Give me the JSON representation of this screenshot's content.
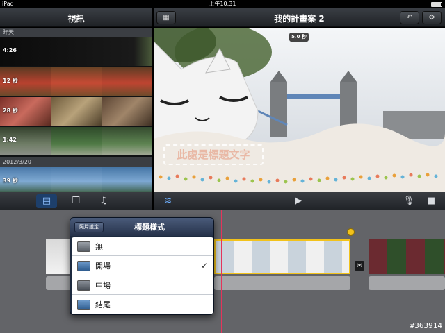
{
  "status_bar": {
    "carrier": "iPad",
    "time": "上午10:31"
  },
  "media_browser": {
    "title": "視訊",
    "sections": [
      {
        "label": "昨天",
        "clips": [
          {
            "duration": "4:26"
          },
          {
            "duration": "12 秒"
          },
          {
            "duration": "28 秒"
          },
          {
            "duration": "1:42"
          }
        ]
      },
      {
        "label": "2012/3/20",
        "clips": [
          {
            "duration": "39 秒"
          }
        ]
      }
    ]
  },
  "project": {
    "title": "我的計畫案 2",
    "clip_duration_badge": "5.0 秒",
    "title_placeholder": "此處是標題文字"
  },
  "title_style_popover": {
    "back_label": "照片設定",
    "title": "標題樣式",
    "options": [
      {
        "label": "無",
        "selected": false,
        "icon": "none-style-icon"
      },
      {
        "label": "開場",
        "selected": true,
        "icon": "opening-style-icon"
      },
      {
        "label": "中場",
        "selected": false,
        "icon": "middle-style-icon"
      },
      {
        "label": "結尾",
        "selected": false,
        "icon": "ending-style-icon"
      }
    ],
    "check_mark": "✓"
  },
  "watermark": "#363914",
  "colors": {
    "accent_blue": "#1d3f6b",
    "playhead": "#e5355c",
    "selection_yellow": "#f2c21b"
  }
}
